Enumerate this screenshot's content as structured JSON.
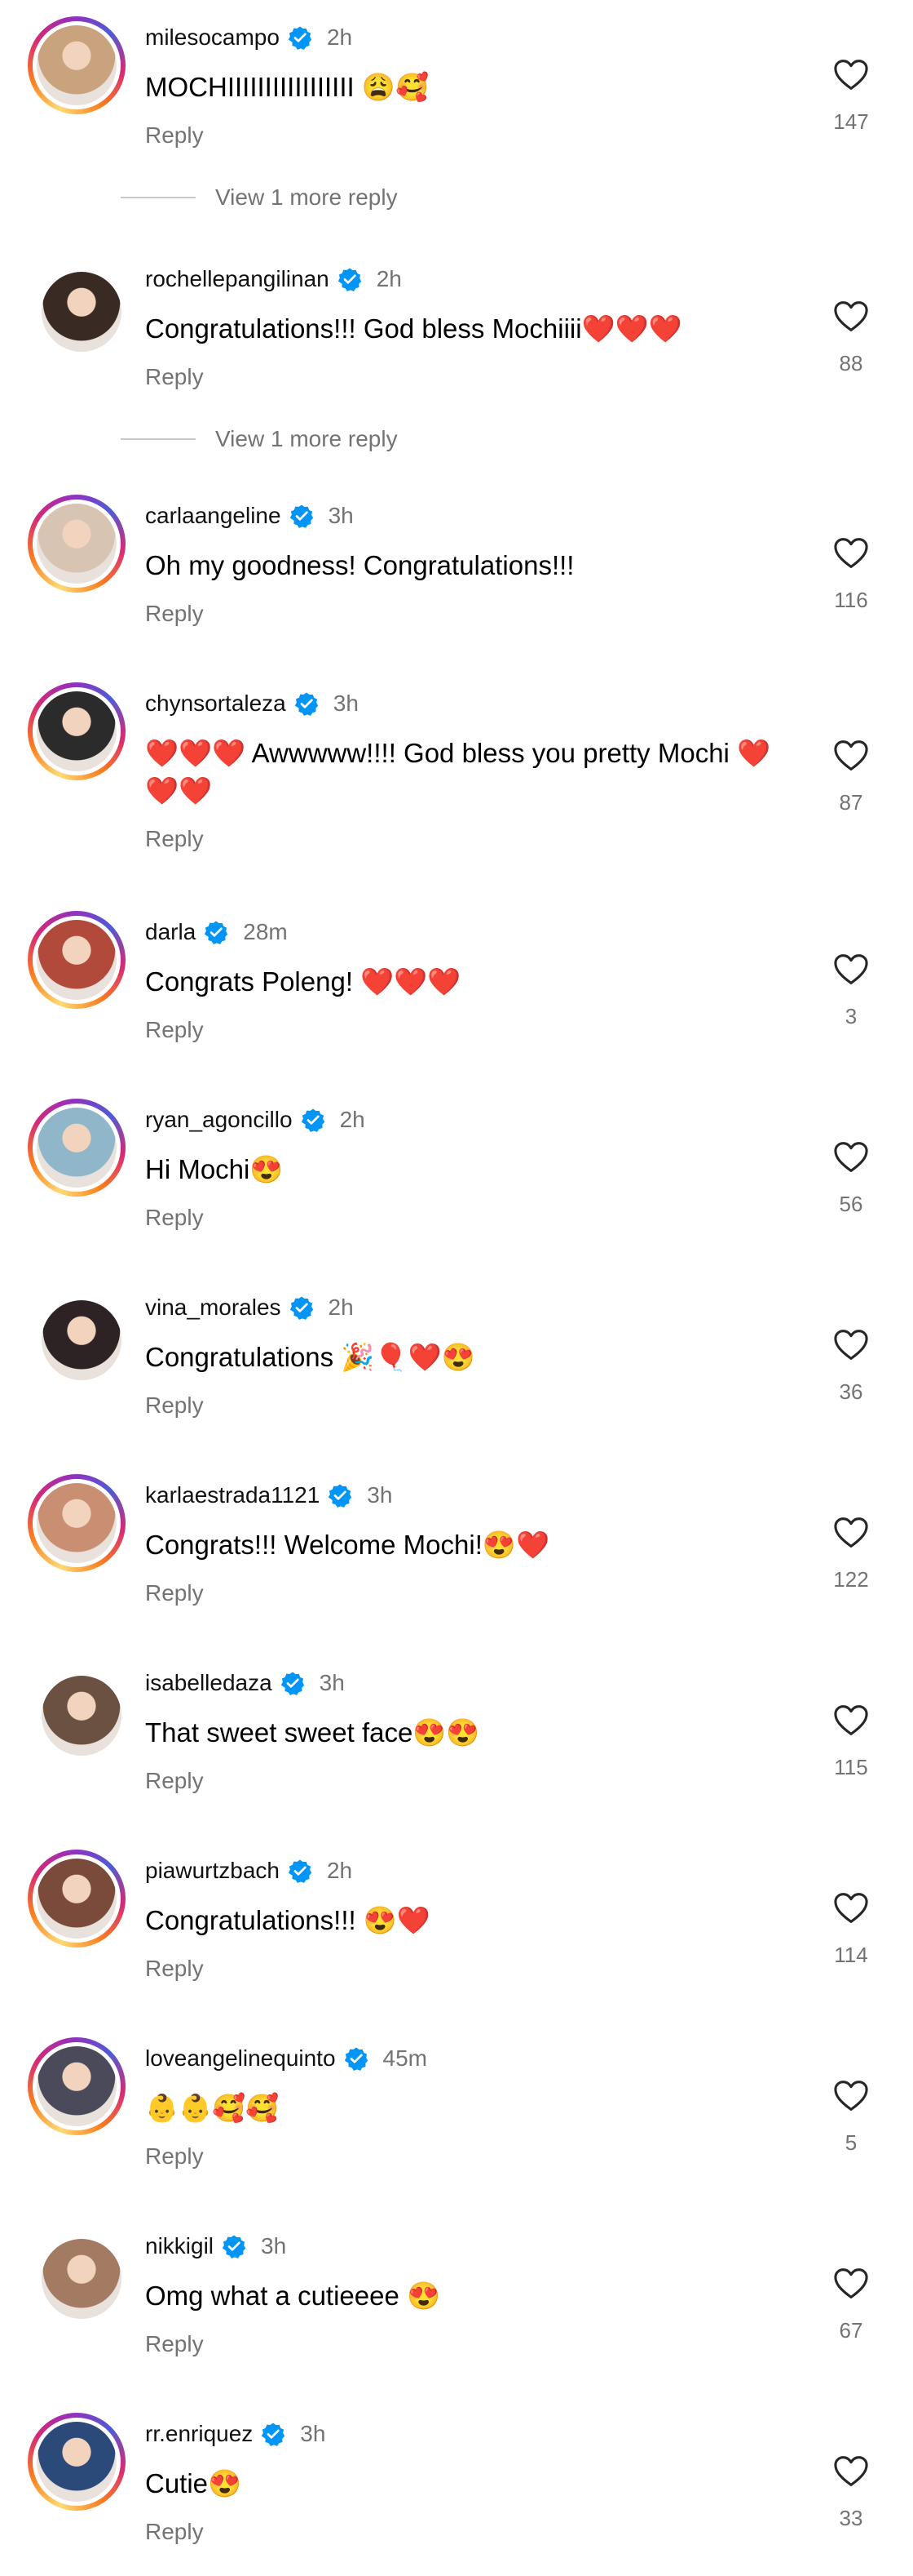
{
  "comments": [
    {
      "username": "milesocampo",
      "time": "2h",
      "text": "MOCHIIIIIIIIIIIIIIIII 😩🥰",
      "reply": "Reply",
      "likes": "147",
      "ring": true,
      "more": "View 1 more reply"
    },
    {
      "username": "rochellepangilinan",
      "time": "2h",
      "text": "Congratulations!!! God bless Mochiiii❤️❤️❤️",
      "reply": "Reply",
      "likes": "88",
      "ring": false,
      "more": "View 1 more reply"
    },
    {
      "username": "carlaangeline",
      "time": "3h",
      "text": "Oh my goodness! Congratulations!!!",
      "reply": "Reply",
      "likes": "116",
      "ring": true
    },
    {
      "username": "chynsortaleza",
      "time": "3h",
      "text": "❤️❤️❤️ Awwwww!!!! God bless you pretty Mochi ❤️❤️❤️",
      "reply": "Reply",
      "likes": "87",
      "ring": true
    },
    {
      "username": "darla",
      "time": "28m",
      "text": "Congrats Poleng! ❤️❤️❤️",
      "reply": "Reply",
      "likes": "3",
      "ring": true
    },
    {
      "username": "ryan_agoncillo",
      "time": "2h",
      "text": "Hi Mochi😍",
      "reply": "Reply",
      "likes": "56",
      "ring": true
    },
    {
      "username": "vina_morales",
      "time": "2h",
      "text": "Congratulations 🎉🎈❤️😍",
      "reply": "Reply",
      "likes": "36",
      "ring": false
    },
    {
      "username": "karlaestrada1121",
      "time": "3h",
      "text": "Congrats!!! Welcome Mochi!😍❤️",
      "reply": "Reply",
      "likes": "122",
      "ring": true
    },
    {
      "username": "isabelledaza",
      "time": "3h",
      "text": "That sweet sweet face😍😍",
      "reply": "Reply",
      "likes": "115",
      "ring": false
    },
    {
      "username": "piawurtzbach",
      "time": "2h",
      "text": "Congratulations!!! 😍❤️",
      "reply": "Reply",
      "likes": "114",
      "ring": true
    },
    {
      "username": "loveangelinequinto",
      "time": "45m",
      "text": "👶👶🥰🥰",
      "reply": "Reply",
      "likes": "5",
      "ring": true
    },
    {
      "username": "nikkigil",
      "time": "3h",
      "text": "Omg what a cutieeee  😍",
      "reply": "Reply",
      "likes": "67",
      "ring": false
    },
    {
      "username": "rr.enriquez",
      "time": "3h",
      "text": "Cutie😍",
      "reply": "Reply",
      "likes": "33",
      "ring": true
    }
  ],
  "colors": {
    "verified": "#0095f6",
    "secondary_text": "#737373",
    "avatar_tones": [
      "#c9a27e",
      "#3a2a24",
      "#d8c4b2",
      "#2b2b2b",
      "#b24a3c",
      "#8fb7c9",
      "#2e2324",
      "#c98f73",
      "#6b5142",
      "#7a4a3a",
      "#4a4a5a",
      "#a37a62",
      "#2b4a7a"
    ]
  },
  "icons": {
    "like": "heart-outline-icon",
    "verified": "verified-badge-icon"
  }
}
